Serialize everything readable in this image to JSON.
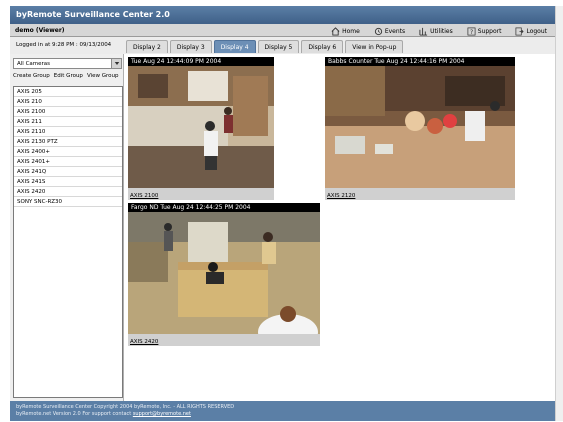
{
  "app": {
    "title": "byRemote Surveillance Center 2.0"
  },
  "user": {
    "label": "demo (Viewer)"
  },
  "nav": [
    {
      "label": "Home",
      "icon": "home-icon"
    },
    {
      "label": "Events",
      "icon": "events-icon"
    },
    {
      "label": "Utilities",
      "icon": "utilities-icon"
    },
    {
      "label": "Support",
      "icon": "support-icon"
    },
    {
      "label": "Logout",
      "icon": "logout-icon"
    }
  ],
  "login_info": "Logged in at 9:28 PM : 09/13/2004",
  "tabs": [
    {
      "label": "Display 2",
      "active": false
    },
    {
      "label": "Display 3",
      "active": false
    },
    {
      "label": "Display 4",
      "active": true
    },
    {
      "label": "Display 5",
      "active": false
    },
    {
      "label": "Display 6",
      "active": false
    },
    {
      "label": "View in Pop-up",
      "active": false
    }
  ],
  "sidebar": {
    "camera_filter": "All Cameras",
    "group_actions": [
      "Create Group",
      "Edit Group",
      "View Group"
    ],
    "cameras": [
      "AXIS 205",
      "AXIS 210",
      "AXIS 2100",
      "AXIS 211",
      "AXIS 2110",
      "AXIS 2130 PTZ",
      "AXIS 2400+",
      "AXIS 2401+",
      "AXIS 241Q",
      "AXIS 241S",
      "AXIS 2420",
      "SONY SNC-RZ30"
    ]
  },
  "feeds": [
    {
      "timestamp": "Tue Aug 24 12:44:09 PM 2004",
      "label": "AXIS 2100"
    },
    {
      "timestamp": "Babbs Counter  Tue Aug 24 12:44:16 PM 2004",
      "label": "AXIS 2120"
    },
    {
      "timestamp": "Fargo ND  Tue Aug 24 12:44:25 PM 2004",
      "label": "AXIS 2420"
    }
  ],
  "footer": {
    "line1": "byRemote Surveillance Center Copyright 2004 byRemote, Inc. - ALL RIGHTS RESERVED",
    "line2_prefix": "byRemote.net Version 2.0 For support contact",
    "support_email": "support@byremote.net"
  },
  "colors": {
    "header": "#5b7fa6",
    "active_tab": "#6c8fb6",
    "footer": "#5b7fa6"
  }
}
